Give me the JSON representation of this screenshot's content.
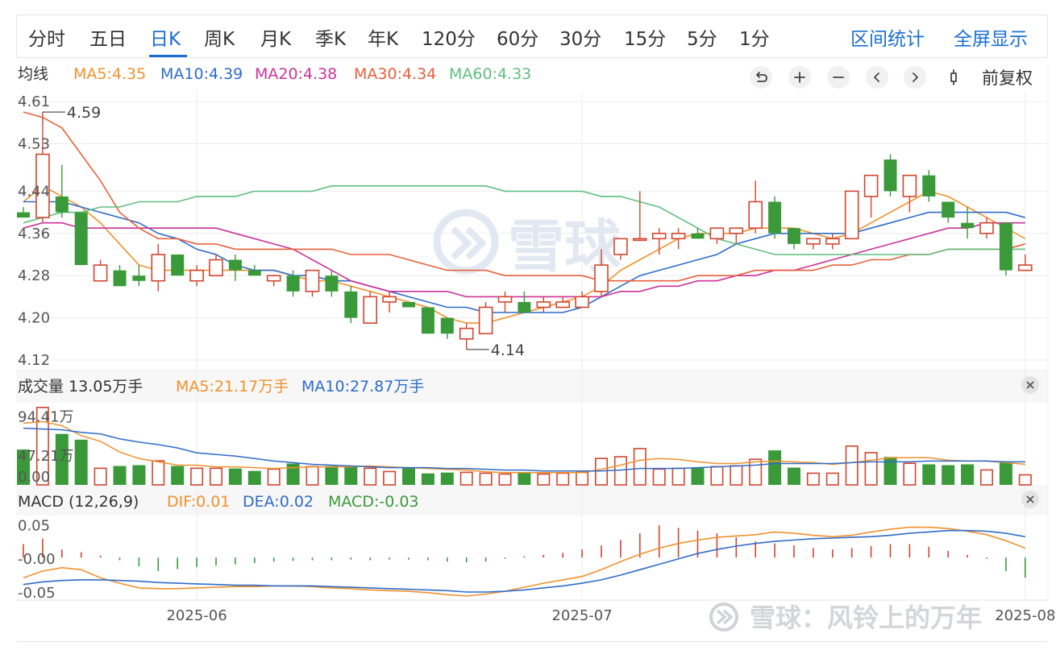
{
  "period_tabs": [
    "分时",
    "五日",
    "日K",
    "周K",
    "月K",
    "季K",
    "年K",
    "120分",
    "60分",
    "30分",
    "15分",
    "5分",
    "1分"
  ],
  "active_tab": "日K",
  "right_links": {
    "range_stats": "区间统计",
    "fullscreen": "全屏显示"
  },
  "ma_legend": {
    "title": "均线",
    "items": [
      {
        "text": "MA5:4.35",
        "color": "#f0912d"
      },
      {
        "text": "MA10:4.39",
        "color": "#2f6cc8"
      },
      {
        "text": "MA20:4.38",
        "color": "#cc3399"
      },
      {
        "text": "MA30:4.34",
        "color": "#e8603c"
      },
      {
        "text": "MA60:4.33",
        "color": "#5fbf7f"
      }
    ]
  },
  "toolbar": {
    "adjust_label": "前复权",
    "buttons": [
      "undo-icon",
      "zoom-in-icon",
      "zoom-out-icon",
      "chevron-left-icon",
      "chevron-right-icon",
      "candle-icon"
    ]
  },
  "volume_legend": {
    "title": "成交量 13.05万手",
    "items": [
      {
        "text": "MA5:21.17万手",
        "color": "#f0912d"
      },
      {
        "text": "MA10:27.87万手",
        "color": "#2f6cc8"
      }
    ]
  },
  "macd_legend": {
    "title": "MACD (12,26,9)",
    "items": [
      {
        "text": "DIF:0.01",
        "color": "#f0912d"
      },
      {
        "text": "DEA:0.02",
        "color": "#2f6cc8"
      },
      {
        "text": "MACD:-0.03",
        "color": "#3a9a3a"
      }
    ]
  },
  "colors": {
    "up": "#d2452f",
    "down": "#3a9a3a",
    "grid": "#ececec",
    "accent": "#1a6fd0"
  },
  "watermark": {
    "text": "雪球",
    "footer_text": "雪球：风铃上的万年"
  },
  "chart_data": [
    {
      "type": "candlestick",
      "name": "price",
      "y_ticks": [
        "4.61",
        "4.53",
        "4.44",
        "4.36",
        "4.28",
        "4.20",
        "4.12"
      ],
      "y_tick_values": [
        4.61,
        4.53,
        4.44,
        4.36,
        4.28,
        4.2,
        4.12
      ],
      "ylim": [
        4.12,
        4.61
      ],
      "x_ticks": [
        {
          "label": "2025-06",
          "index": 9
        },
        {
          "label": "2025-07",
          "index": 29
        },
        {
          "label": "2025-08",
          "index": 52
        }
      ],
      "annotations": [
        {
          "text": "4.59",
          "index": 1,
          "value": 4.59
        },
        {
          "text": "4.14",
          "index": 23,
          "value": 4.14
        }
      ],
      "candles": [
        {
          "o": 4.4,
          "h": 4.41,
          "l": 4.39,
          "c": 4.39
        },
        {
          "o": 4.39,
          "h": 4.59,
          "l": 4.38,
          "c": 4.51
        },
        {
          "o": 4.43,
          "h": 4.49,
          "l": 4.39,
          "c": 4.4
        },
        {
          "o": 4.4,
          "h": 4.4,
          "l": 4.3,
          "c": 4.3
        },
        {
          "o": 4.27,
          "h": 4.31,
          "l": 4.27,
          "c": 4.3
        },
        {
          "o": 4.29,
          "h": 4.3,
          "l": 4.26,
          "c": 4.26
        },
        {
          "o": 4.28,
          "h": 4.3,
          "l": 4.26,
          "c": 4.27
        },
        {
          "o": 4.27,
          "h": 4.34,
          "l": 4.25,
          "c": 4.32
        },
        {
          "o": 4.32,
          "h": 4.32,
          "l": 4.28,
          "c": 4.28
        },
        {
          "o": 4.27,
          "h": 4.3,
          "l": 4.26,
          "c": 4.29
        },
        {
          "o": 4.28,
          "h": 4.32,
          "l": 4.28,
          "c": 4.31
        },
        {
          "o": 4.31,
          "h": 4.32,
          "l": 4.27,
          "c": 4.29
        },
        {
          "o": 4.29,
          "h": 4.3,
          "l": 4.28,
          "c": 4.28
        },
        {
          "o": 4.27,
          "h": 4.28,
          "l": 4.26,
          "c": 4.28
        },
        {
          "o": 4.28,
          "h": 4.29,
          "l": 4.24,
          "c": 4.25
        },
        {
          "o": 4.25,
          "h": 4.29,
          "l": 4.24,
          "c": 4.29
        },
        {
          "o": 4.28,
          "h": 4.29,
          "l": 4.24,
          "c": 4.25
        },
        {
          "o": 4.25,
          "h": 4.26,
          "l": 4.19,
          "c": 4.2
        },
        {
          "o": 4.19,
          "h": 4.25,
          "l": 4.19,
          "c": 4.24
        },
        {
          "o": 4.23,
          "h": 4.25,
          "l": 4.21,
          "c": 4.24
        },
        {
          "o": 4.23,
          "h": 4.23,
          "l": 4.22,
          "c": 4.22
        },
        {
          "o": 4.22,
          "h": 4.22,
          "l": 4.17,
          "c": 4.17
        },
        {
          "o": 4.2,
          "h": 4.2,
          "l": 4.16,
          "c": 4.17
        },
        {
          "o": 4.16,
          "h": 4.19,
          "l": 4.14,
          "c": 4.18
        },
        {
          "o": 4.17,
          "h": 4.23,
          "l": 4.17,
          "c": 4.22
        },
        {
          "o": 4.23,
          "h": 4.25,
          "l": 4.21,
          "c": 4.24
        },
        {
          "o": 4.23,
          "h": 4.25,
          "l": 4.21,
          "c": 4.21
        },
        {
          "o": 4.22,
          "h": 4.24,
          "l": 4.21,
          "c": 4.23
        },
        {
          "o": 4.22,
          "h": 4.24,
          "l": 4.22,
          "c": 4.23
        },
        {
          "o": 4.22,
          "h": 4.25,
          "l": 4.22,
          "c": 4.24
        },
        {
          "o": 4.25,
          "h": 4.33,
          "l": 4.24,
          "c": 4.3
        },
        {
          "o": 4.32,
          "h": 4.35,
          "l": 4.31,
          "c": 4.35
        },
        {
          "o": 4.35,
          "h": 4.44,
          "l": 4.35,
          "c": 4.35
        },
        {
          "o": 4.35,
          "h": 4.37,
          "l": 4.32,
          "c": 4.36
        },
        {
          "o": 4.35,
          "h": 4.37,
          "l": 4.33,
          "c": 4.36
        },
        {
          "o": 4.36,
          "h": 4.37,
          "l": 4.35,
          "c": 4.35
        },
        {
          "o": 4.35,
          "h": 4.37,
          "l": 4.34,
          "c": 4.37
        },
        {
          "o": 4.36,
          "h": 4.37,
          "l": 4.34,
          "c": 4.37
        },
        {
          "o": 4.37,
          "h": 4.46,
          "l": 4.36,
          "c": 4.42
        },
        {
          "o": 4.42,
          "h": 4.43,
          "l": 4.35,
          "c": 4.36
        },
        {
          "o": 4.37,
          "h": 4.37,
          "l": 4.33,
          "c": 4.34
        },
        {
          "o": 4.34,
          "h": 4.35,
          "l": 4.33,
          "c": 4.35
        },
        {
          "o": 4.34,
          "h": 4.36,
          "l": 4.33,
          "c": 4.35
        },
        {
          "o": 4.35,
          "h": 4.44,
          "l": 4.35,
          "c": 4.44
        },
        {
          "o": 4.43,
          "h": 4.47,
          "l": 4.39,
          "c": 4.47
        },
        {
          "o": 4.5,
          "h": 4.51,
          "l": 4.43,
          "c": 4.44
        },
        {
          "o": 4.43,
          "h": 4.47,
          "l": 4.4,
          "c": 4.47
        },
        {
          "o": 4.47,
          "h": 4.48,
          "l": 4.42,
          "c": 4.43
        },
        {
          "o": 4.42,
          "h": 4.42,
          "l": 4.38,
          "c": 4.39
        },
        {
          "o": 4.38,
          "h": 4.41,
          "l": 4.35,
          "c": 4.37
        },
        {
          "o": 4.36,
          "h": 4.39,
          "l": 4.35,
          "c": 4.38
        },
        {
          "o": 4.38,
          "h": 4.38,
          "l": 4.28,
          "c": 4.29
        },
        {
          "o": 4.29,
          "h": 4.32,
          "l": 4.29,
          "c": 4.3
        }
      ],
      "series": [
        {
          "name": "MA5",
          "color": "#f0912d",
          "values": [
            4.42,
            4.45,
            4.43,
            4.41,
            4.38,
            4.34,
            4.3,
            4.29,
            4.29,
            4.29,
            4.29,
            4.29,
            4.29,
            4.29,
            4.28,
            4.27,
            4.27,
            4.26,
            4.25,
            4.24,
            4.23,
            4.22,
            4.2,
            4.19,
            4.19,
            4.2,
            4.21,
            4.22,
            4.23,
            4.24,
            4.26,
            4.29,
            4.31,
            4.33,
            4.35,
            4.36,
            4.36,
            4.36,
            4.37,
            4.37,
            4.37,
            4.36,
            4.35,
            4.36,
            4.38,
            4.4,
            4.42,
            4.44,
            4.43,
            4.41,
            4.39,
            4.37,
            4.35
          ]
        },
        {
          "name": "MA10",
          "color": "#2f6cc8",
          "values": [
            4.42,
            4.42,
            4.42,
            4.41,
            4.4,
            4.39,
            4.38,
            4.36,
            4.35,
            4.33,
            4.32,
            4.3,
            4.29,
            4.29,
            4.28,
            4.28,
            4.27,
            4.27,
            4.26,
            4.25,
            4.24,
            4.23,
            4.22,
            4.22,
            4.21,
            4.21,
            4.21,
            4.21,
            4.21,
            4.22,
            4.24,
            4.26,
            4.28,
            4.29,
            4.3,
            4.31,
            4.32,
            4.34,
            4.35,
            4.36,
            4.36,
            4.36,
            4.36,
            4.36,
            4.37,
            4.38,
            4.39,
            4.4,
            4.4,
            4.4,
            4.4,
            4.4,
            4.39
          ]
        },
        {
          "name": "MA20",
          "color": "#cc3399",
          "values": [
            4.37,
            4.38,
            4.38,
            4.37,
            4.37,
            4.37,
            4.37,
            4.37,
            4.37,
            4.37,
            4.37,
            4.36,
            4.35,
            4.34,
            4.33,
            4.31,
            4.29,
            4.27,
            4.26,
            4.25,
            4.25,
            4.25,
            4.25,
            4.24,
            4.24,
            4.24,
            4.24,
            4.24,
            4.24,
            4.24,
            4.24,
            4.25,
            4.25,
            4.26,
            4.26,
            4.27,
            4.27,
            4.28,
            4.28,
            4.29,
            4.29,
            4.3,
            4.31,
            4.32,
            4.33,
            4.34,
            4.35,
            4.36,
            4.37,
            4.37,
            4.38,
            4.38,
            4.38
          ]
        },
        {
          "name": "MA30",
          "color": "#e8603c",
          "values": [
            4.59,
            4.58,
            4.56,
            4.51,
            4.46,
            4.4,
            4.37,
            4.35,
            4.35,
            4.34,
            4.34,
            4.33,
            4.33,
            4.33,
            4.33,
            4.33,
            4.33,
            4.32,
            4.32,
            4.32,
            4.31,
            4.3,
            4.29,
            4.29,
            4.29,
            4.28,
            4.28,
            4.28,
            4.28,
            4.28,
            4.27,
            4.27,
            4.27,
            4.27,
            4.27,
            4.28,
            4.28,
            4.28,
            4.29,
            4.29,
            4.29,
            4.29,
            4.3,
            4.3,
            4.31,
            4.31,
            4.32,
            4.32,
            4.33,
            4.33,
            4.33,
            4.33,
            4.34
          ]
        },
        {
          "name": "MA60",
          "color": "#5fbf7f",
          "values": [
            4.38,
            4.39,
            4.4,
            4.4,
            4.41,
            4.41,
            4.42,
            4.42,
            4.42,
            4.43,
            4.43,
            4.43,
            4.44,
            4.44,
            4.44,
            4.44,
            4.45,
            4.45,
            4.45,
            4.45,
            4.45,
            4.45,
            4.45,
            4.45,
            4.45,
            4.44,
            4.44,
            4.44,
            4.44,
            4.44,
            4.43,
            4.43,
            4.42,
            4.41,
            4.39,
            4.37,
            4.35,
            4.34,
            4.33,
            4.32,
            4.32,
            4.32,
            4.32,
            4.32,
            4.32,
            4.32,
            4.32,
            4.32,
            4.33,
            4.33,
            4.33,
            4.33,
            4.33
          ]
        }
      ]
    },
    {
      "type": "bar",
      "name": "volume",
      "y_ticks": [
        "94.41万",
        "47.21万",
        "0.00"
      ],
      "y_tick_values": [
        94.41,
        47.21,
        0
      ],
      "ylim": [
        0,
        98
      ],
      "values": [
        43,
        95,
        62,
        55,
        21,
        23,
        24,
        30,
        23,
        21,
        21,
        20,
        17,
        20,
        26,
        23,
        23,
        23,
        21,
        17,
        21,
        14,
        15,
        16,
        15,
        14,
        15,
        14,
        15,
        16,
        33,
        35,
        45,
        20,
        21,
        21,
        23,
        24,
        32,
        42,
        21,
        15,
        15,
        48,
        40,
        34,
        27,
        25,
        24,
        25,
        19,
        27,
        13
      ],
      "series": [
        {
          "name": "MA5",
          "color": "#f0912d",
          "values": [
            75,
            77,
            72,
            60,
            53,
            40,
            32,
            28,
            24,
            24,
            22,
            22,
            21,
            20,
            21,
            22,
            22,
            22,
            23,
            22,
            21,
            20,
            19,
            18,
            16,
            15,
            15,
            15,
            15,
            15,
            19,
            24,
            30,
            32,
            31,
            28,
            26,
            26,
            28,
            29,
            28,
            27,
            25,
            27,
            30,
            33,
            33,
            33,
            30,
            29,
            29,
            27,
            25
          ]
        },
        {
          "name": "MA10",
          "color": "#2f6cc8",
          "values": [
            69,
            68,
            67,
            64,
            62,
            56,
            52,
            49,
            45,
            39,
            37,
            35,
            32,
            29,
            27,
            25,
            24,
            23,
            22,
            21,
            21,
            21,
            20,
            20,
            19,
            18,
            18,
            17,
            17,
            17,
            17,
            18,
            20,
            20,
            20,
            21,
            22,
            23,
            24,
            26,
            26,
            26,
            26,
            27,
            28,
            28,
            28,
            29,
            29,
            29,
            29,
            28,
            28
          ]
        }
      ]
    },
    {
      "type": "macd",
      "name": "MACD (12,26,9)",
      "y_ticks": [
        "0.05",
        "-0.00",
        "-0.05"
      ],
      "y_tick_values": [
        0.05,
        0,
        -0.05
      ],
      "ylim": [
        -0.063,
        0.06
      ],
      "histogram": [
        0.02,
        0.028,
        0.012,
        0.008,
        0.003,
        -0.004,
        -0.013,
        -0.02,
        -0.017,
        -0.014,
        -0.012,
        -0.01,
        -0.008,
        -0.006,
        -0.005,
        -0.004,
        -0.004,
        -0.003,
        -0.004,
        -0.003,
        -0.003,
        -0.004,
        -0.006,
        -0.007,
        -0.006,
        -0.002,
        0.002,
        0.004,
        0.007,
        0.012,
        0.018,
        0.026,
        0.036,
        0.048,
        0.044,
        0.04,
        0.036,
        0.03,
        0.024,
        0.021,
        0.018,
        0.014,
        0.012,
        0.014,
        0.017,
        0.02,
        0.02,
        0.016,
        0.01,
        0.004,
        -0.002,
        -0.02,
        -0.03
      ],
      "series": [
        {
          "name": "DIF",
          "color": "#f0912d",
          "values": [
            -0.03,
            -0.02,
            -0.015,
            -0.018,
            -0.03,
            -0.038,
            -0.045,
            -0.046,
            -0.046,
            -0.045,
            -0.044,
            -0.043,
            -0.043,
            -0.042,
            -0.042,
            -0.043,
            -0.045,
            -0.046,
            -0.048,
            -0.049,
            -0.05,
            -0.052,
            -0.055,
            -0.057,
            -0.054,
            -0.05,
            -0.044,
            -0.038,
            -0.033,
            -0.028,
            -0.018,
            -0.006,
            0.005,
            0.014,
            0.021,
            0.026,
            0.03,
            0.032,
            0.034,
            0.038,
            0.036,
            0.033,
            0.031,
            0.033,
            0.038,
            0.042,
            0.045,
            0.045,
            0.043,
            0.039,
            0.034,
            0.025,
            0.014
          ]
        },
        {
          "name": "DEA",
          "color": "#2f6cc8",
          "values": [
            -0.04,
            -0.036,
            -0.034,
            -0.033,
            -0.033,
            -0.034,
            -0.035,
            -0.037,
            -0.038,
            -0.039,
            -0.04,
            -0.041,
            -0.041,
            -0.042,
            -0.042,
            -0.042,
            -0.043,
            -0.044,
            -0.045,
            -0.046,
            -0.047,
            -0.048,
            -0.049,
            -0.051,
            -0.051,
            -0.05,
            -0.048,
            -0.045,
            -0.042,
            -0.038,
            -0.033,
            -0.026,
            -0.018,
            -0.01,
            -0.002,
            0.006,
            0.012,
            0.017,
            0.021,
            0.024,
            0.026,
            0.028,
            0.029,
            0.03,
            0.031,
            0.033,
            0.036,
            0.038,
            0.04,
            0.04,
            0.039,
            0.036,
            0.031
          ]
        }
      ]
    }
  ]
}
